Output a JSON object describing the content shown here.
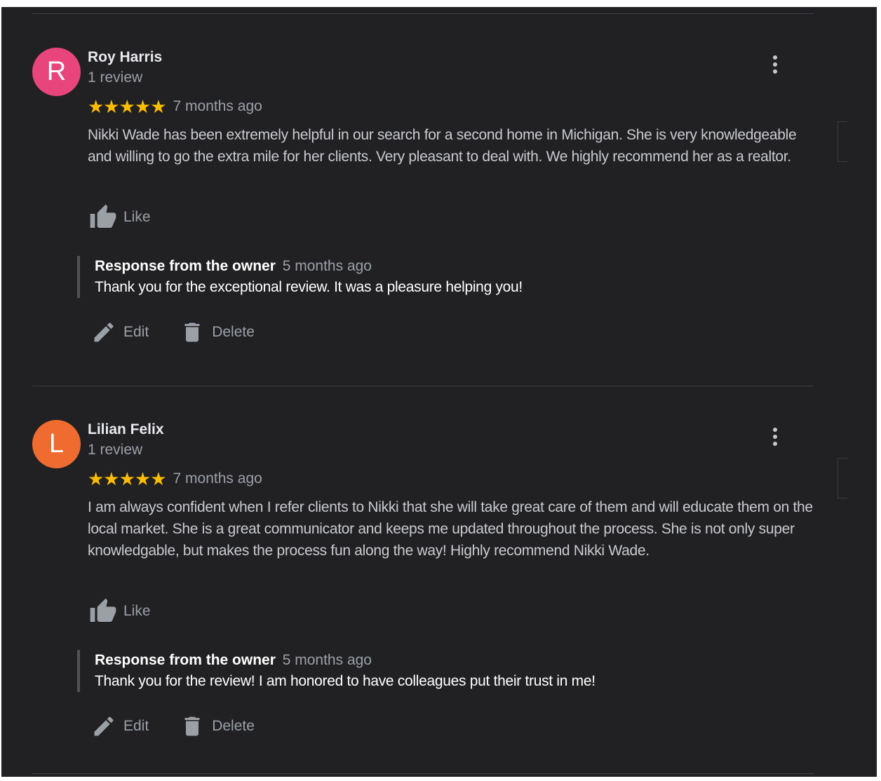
{
  "colors": {
    "background": "#212124",
    "star": "#fbbc04",
    "avatar_roy": "#e8457c",
    "avatar_lilian": "#ef6b2f"
  },
  "reviews": [
    {
      "avatar_letter": "R",
      "avatar_color": "#e8457c",
      "name": "Roy Harris",
      "review_count": "1 review",
      "rating": 5,
      "stars": "★★★★★",
      "time": "7 months ago",
      "text": "Nikki Wade has been extremely helpful in our search for a second home in Michigan. She is very knowledgeable and willing to go the extra mile for her clients. Very pleasant to deal with. We highly recommend her as a realtor.",
      "like_label": "Like",
      "response": {
        "title": "Response from the owner",
        "time": "5 months ago",
        "text": "Thank you for the exceptional review. It was a pleasure helping you!"
      },
      "edit_label": "Edit",
      "delete_label": "Delete"
    },
    {
      "avatar_letter": "L",
      "avatar_color": "#ef6b2f",
      "name": "Lilian Felix",
      "review_count": "1 review",
      "rating": 5,
      "stars": "★★★★★",
      "time": "7 months ago",
      "text": "I am always confident when I refer clients to Nikki that she will take great care of them and will educate them on the local market. She is a great communicator and keeps me updated throughout the process. She is not only super knowledgable, but makes the process fun along the way! Highly recommend Nikki Wade.",
      "like_label": "Like",
      "response": {
        "title": "Response from the owner",
        "time": "5 months ago",
        "text": "Thank you for the review! I am honored to have colleagues put their trust in me!"
      },
      "edit_label": "Edit",
      "delete_label": "Delete"
    }
  ]
}
